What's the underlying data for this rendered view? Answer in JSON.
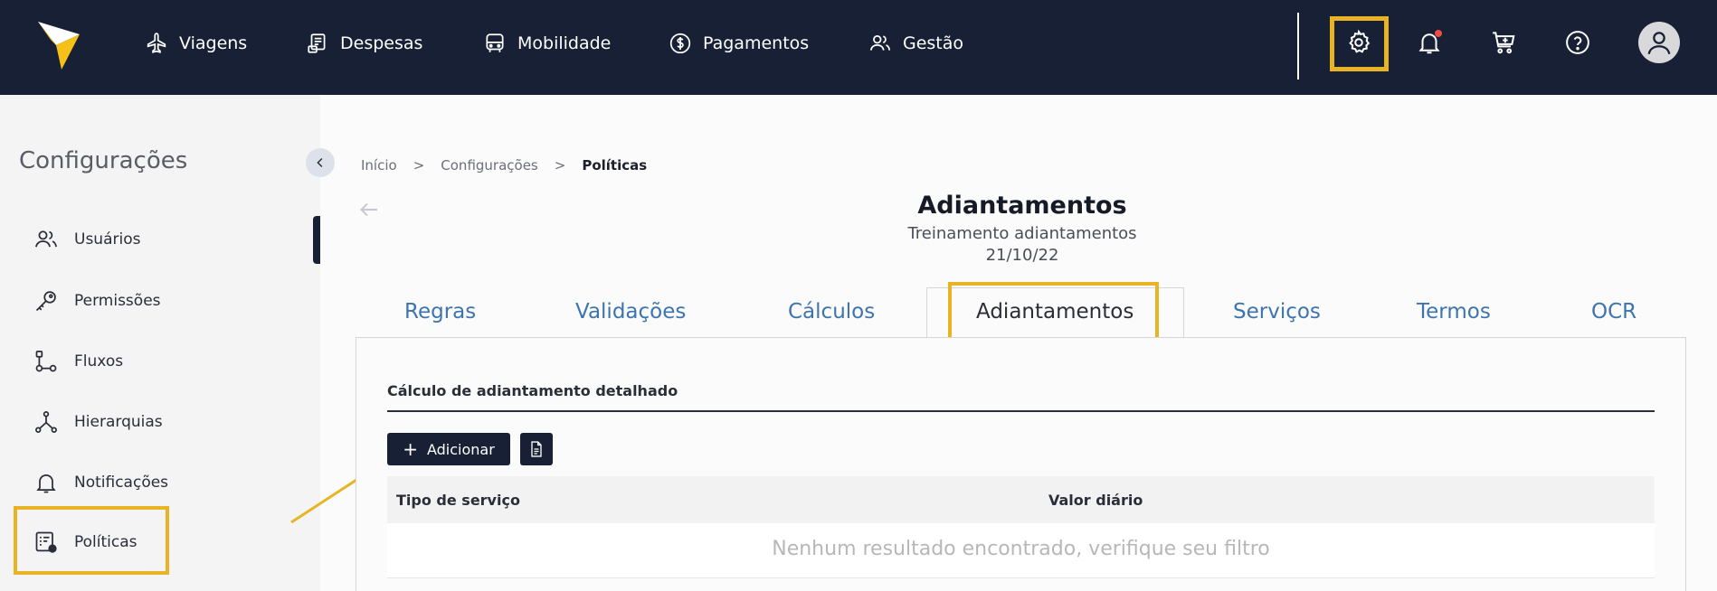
{
  "topnav": {
    "items": [
      {
        "label": "Viagens",
        "icon": "plane-icon"
      },
      {
        "label": "Despesas",
        "icon": "receipt-icon"
      },
      {
        "label": "Mobilidade",
        "icon": "car-icon"
      },
      {
        "label": "Pagamentos",
        "icon": "dollar-icon"
      },
      {
        "label": "Gestão",
        "icon": "users-icon"
      }
    ],
    "actions": [
      "gear-icon",
      "bell-icon",
      "cart-icon",
      "help-icon",
      "avatar"
    ],
    "highlight_color": "#e9b424",
    "notification_dot_color": "#f04b4b"
  },
  "sidebar": {
    "title": "Configurações",
    "items": [
      {
        "label": "Usuários",
        "icon": "users-icon"
      },
      {
        "label": "Permissões",
        "icon": "key-icon"
      },
      {
        "label": "Fluxos",
        "icon": "flow-icon"
      },
      {
        "label": "Hierarquias",
        "icon": "hierarchy-icon"
      },
      {
        "label": "Notificações",
        "icon": "bell-icon"
      },
      {
        "label": "Políticas",
        "icon": "policy-icon"
      }
    ]
  },
  "breadcrumb": {
    "items": [
      "Início",
      "Configurações",
      "Políticas"
    ]
  },
  "page": {
    "title": "Adiantamentos",
    "subtitle": "Treinamento adiantamentos",
    "date": "21/10/22"
  },
  "tabs": {
    "items": [
      "Regras",
      "Validações",
      "Cálculos",
      "Adiantamentos",
      "Serviços",
      "Termos",
      "OCR"
    ],
    "active": "Adiantamentos"
  },
  "section": {
    "title": "Cálculo de adiantamento detalhado",
    "add_label": "Adicionar"
  },
  "table": {
    "columns": [
      "Tipo de serviço",
      "Valor diário"
    ],
    "empty_message": "Nenhum resultado encontrado, verifique seu filtro"
  },
  "colors": {
    "navy": "#182035",
    "tab_blue": "#3d74b0"
  }
}
